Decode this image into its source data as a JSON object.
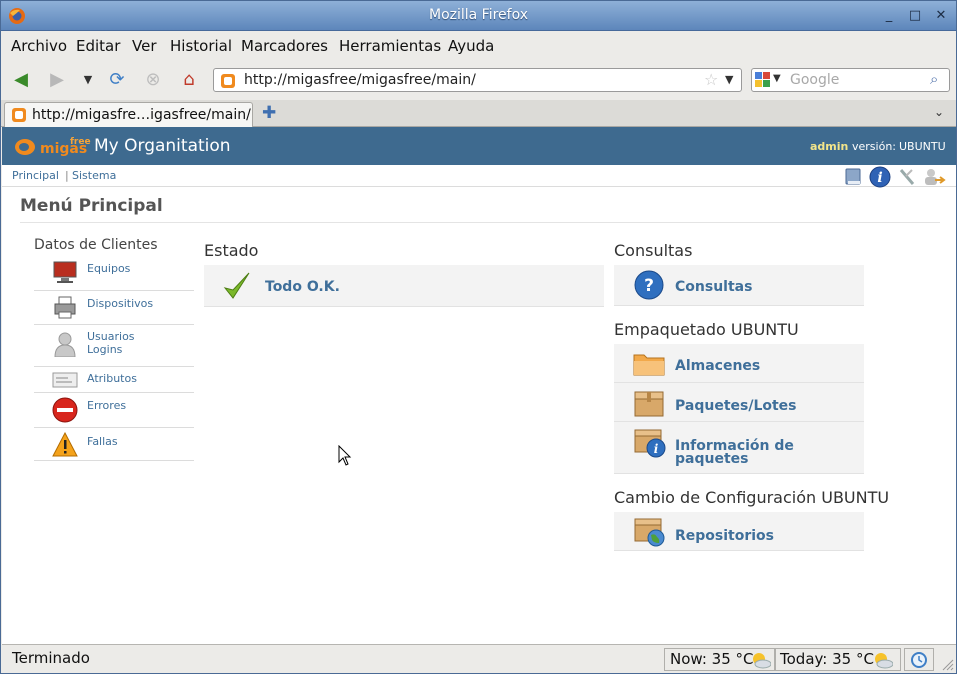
{
  "window": {
    "title": "Mozilla Firefox"
  },
  "menu": [
    "Archivo",
    "Editar",
    "Ver",
    "Historial",
    "Marcadores",
    "Herramientas",
    "Ayuda"
  ],
  "nav": {
    "url": "http://migasfree/migasfree/main/",
    "search_placeholder": "Google"
  },
  "tab": {
    "label": "http://migasfre…igasfree/main/"
  },
  "app": {
    "logo_small": "free",
    "logo_main": "migas",
    "org": "My Organitation",
    "user": "admin",
    "version_label": "versión:",
    "version_value": "UBUNTU"
  },
  "crumbs": {
    "principal": "Principal",
    "sep": "|",
    "sistema": "Sistema"
  },
  "page_title": "Menú Principal",
  "sidebar": {
    "title": "Datos de Clientes",
    "items": [
      {
        "label": "Equipos",
        "icon": "computer-icon"
      },
      {
        "label": "Dispositivos",
        "icon": "printer-icon"
      },
      {
        "label": "Usuarios",
        "label2": "Logins",
        "icon": "user-icon"
      },
      {
        "label": "Atributos",
        "icon": "card-icon"
      },
      {
        "label": "Errores",
        "icon": "error-icon"
      },
      {
        "label": "Fallas",
        "icon": "warning-icon"
      }
    ]
  },
  "estado": {
    "title": "Estado",
    "item": "Todo O.K."
  },
  "consultas": {
    "title": "Consultas",
    "item": "Consultas"
  },
  "empaquetado": {
    "title": "Empaquetado UBUNTU",
    "items": [
      "Almacenes",
      "Paquetes/Lotes"
    ],
    "info1": "Información de",
    "info2": "paquetes"
  },
  "cambio": {
    "title": "Cambio de Configuración UBUNTU",
    "item": "Repositorios"
  },
  "status": {
    "text": "Terminado",
    "now": "Now: 35 °C",
    "today": "Today: 35 °C"
  },
  "colors": {
    "header": "#3e6a8f",
    "link": "#3f6f9a",
    "logo_orange": "#f08a1e"
  }
}
